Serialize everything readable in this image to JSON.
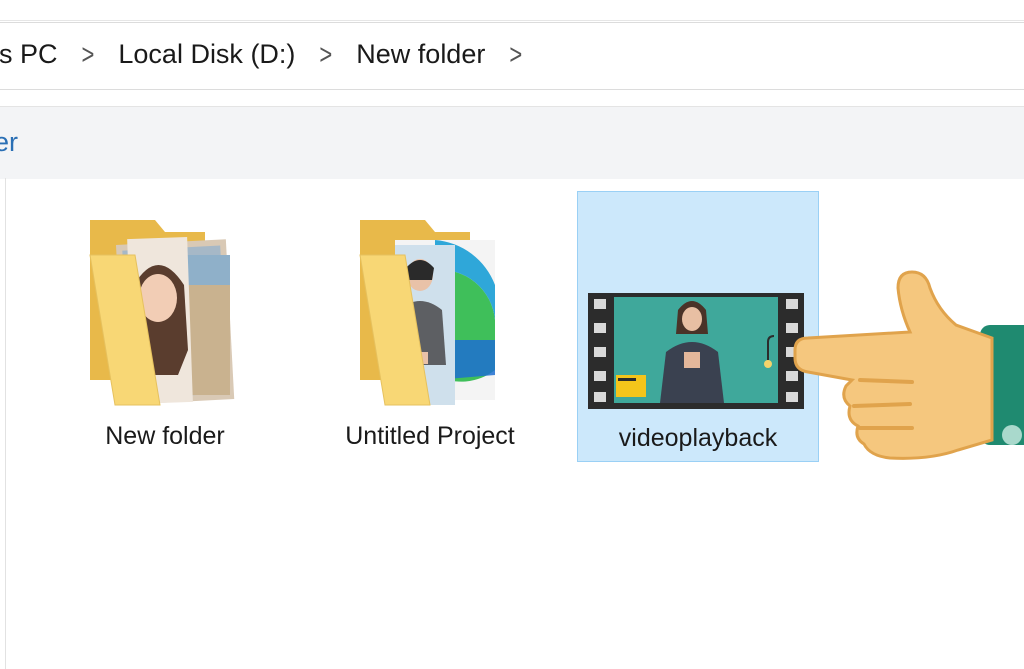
{
  "breadcrumb": {
    "items": [
      "his PC",
      "Local Disk (D:)",
      "New folder"
    ],
    "separator": ">"
  },
  "toolbar": {
    "partial_label": "er"
  },
  "files": [
    {
      "name": "New folder",
      "type": "folder-with-photos"
    },
    {
      "name": "Untitled Project",
      "type": "folder-with-photos"
    },
    {
      "name": "videoplayback",
      "type": "video-file",
      "selected": true
    }
  ],
  "colors": {
    "folder_yellow": "#f8d775",
    "selection_fill": "#cce8fb",
    "selection_border": "#9ad0f5",
    "hand_skin": "#f5c77e",
    "sleeve_green": "#1f8a70"
  }
}
